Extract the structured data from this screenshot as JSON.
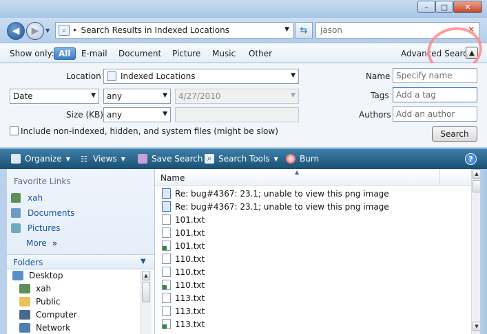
{
  "window": {
    "minimize": "–",
    "maximize": "□",
    "close": "✕"
  },
  "address": {
    "path": "Search Results in Indexed Locations",
    "separator": "▸",
    "search_query": "jason",
    "clear": "✕"
  },
  "showonly": {
    "label": "Show only:",
    "filters": [
      "All",
      "E-mail",
      "Document",
      "Picture",
      "Music",
      "Other"
    ],
    "advanced_label": "Advanced Search"
  },
  "advanced": {
    "location_label": "Location",
    "location_value": "Indexed Locations",
    "date_field": "Date",
    "date_op": "any",
    "date_value": "4/27/2010",
    "size_label": "Size (KB)",
    "size_op": "any",
    "include_label": "Include non-indexed, hidden, and system files (might be slow)",
    "name_label": "Name",
    "name_placeholder": "Specify name",
    "tags_label": "Tags",
    "tags_placeholder": "Add a tag",
    "authors_label": "Authors",
    "authors_placeholder": "Add an author",
    "search_button": "Search"
  },
  "toolbar": {
    "organize": "Organize",
    "views": "Views",
    "save_search": "Save Search",
    "search_tools": "Search Tools",
    "burn": "Burn",
    "help": "?"
  },
  "leftnav": {
    "favorites_title": "Favorite Links",
    "favorites": [
      "xah",
      "Documents",
      "Pictures"
    ],
    "more": "More",
    "folders_title": "Folders",
    "tree": [
      "Desktop",
      "xah",
      "Public",
      "Computer",
      "Network"
    ]
  },
  "main": {
    "column_name": "Name",
    "files": [
      {
        "name": "Re: bug#4367: 23.1; unable to view this png image",
        "icon": "mail"
      },
      {
        "name": "Re: bug#4367: 23.1; unable to view this png image",
        "icon": "mail"
      },
      {
        "name": "101.txt",
        "icon": "txt"
      },
      {
        "name": "101.txt",
        "icon": "txt"
      },
      {
        "name": "101.txt",
        "icon": "xl"
      },
      {
        "name": "110.txt",
        "icon": "txt"
      },
      {
        "name": "110.txt",
        "icon": "txt"
      },
      {
        "name": "110.txt",
        "icon": "xl"
      },
      {
        "name": "113.txt",
        "icon": "txt"
      },
      {
        "name": "113.txt",
        "icon": "txt"
      },
      {
        "name": "113.txt",
        "icon": "xl"
      }
    ]
  },
  "colors": {
    "toolbar": "#1a4f72",
    "accent": "#3b7cc8",
    "annotation": "#ff8a8a"
  }
}
